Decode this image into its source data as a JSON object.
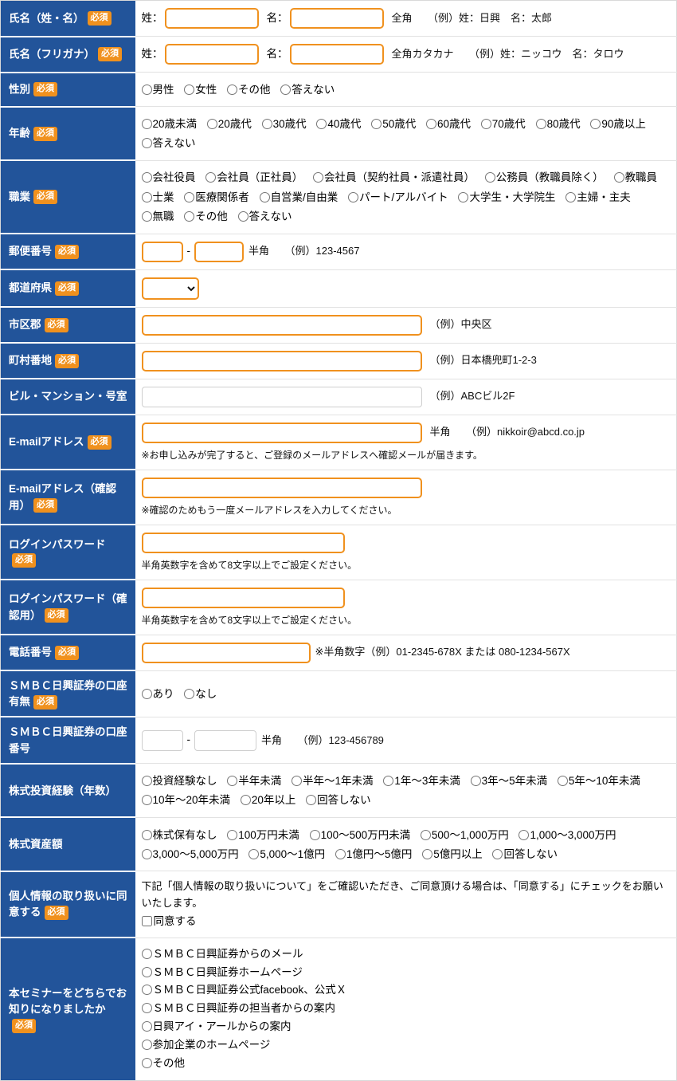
{
  "theme": {
    "label_bg": "#22549A",
    "required_badge_bg": "#F0911E",
    "input_border": "#F0911E",
    "optional_input_border": "#cfcfcf",
    "row_divider": "#e2e2e2"
  },
  "badges": {
    "required": "必須"
  },
  "rows": {
    "name": {
      "label": "氏名（姓・名）",
      "required": true,
      "sei_label": "姓：",
      "mei_label": "名：",
      "sei_value": "",
      "mei_value": "",
      "hint": "全角　　（例）姓：日興　名：太郎"
    },
    "furigana": {
      "label": "氏名（フリガナ）",
      "required": true,
      "sei_label": "姓：",
      "mei_label": "名：",
      "sei_value": "",
      "mei_value": "",
      "hint": "全角カタカナ　　（例）姓：ニッコウ　名：タロウ"
    },
    "gender": {
      "label": "性別",
      "required": true,
      "options": [
        "男性",
        "女性",
        "その他",
        "答えない"
      ]
    },
    "age": {
      "label": "年齢",
      "required": true,
      "options": [
        "20歳未満",
        "20歳代",
        "30歳代",
        "40歳代",
        "50歳代",
        "60歳代",
        "70歳代",
        "80歳代",
        "90歳以上",
        "答えない"
      ]
    },
    "occupation": {
      "label": "職業",
      "required": true,
      "options": [
        "会社役員",
        "会社員（正社員）",
        "会社員（契約社員・派遣社員）",
        "公務員（教職員除く）",
        "教職員",
        "士業",
        "医療関係者",
        "自営業/自由業",
        "パート/アルバイト",
        "大学生・大学院生",
        "主婦・主夫",
        "無職",
        "その他",
        "答えない"
      ]
    },
    "postal": {
      "label": "郵便番号",
      "required": true,
      "value_a": "",
      "value_b": "",
      "separator": "-",
      "hint": "半角　　（例）123-4567"
    },
    "prefecture": {
      "label": "都道府県",
      "required": true,
      "selected": "",
      "options": [
        ""
      ]
    },
    "city": {
      "label": "市区郡",
      "required": true,
      "value": "",
      "hint": "（例）中央区"
    },
    "town": {
      "label": "町村番地",
      "required": true,
      "value": "",
      "hint": "（例）日本橋兜町1-2-3"
    },
    "building": {
      "label": "ビル・マンション・号室",
      "required": false,
      "value": "",
      "hint": "（例）ABCビル2F"
    },
    "email": {
      "label": "E-mailアドレス",
      "required": true,
      "value": "",
      "hint": "半角　　（例）nikkoir@abcd.co.jp",
      "note": "※お申し込みが完了すると、ご登録のメールアドレスへ確認メールが届きます。"
    },
    "email_confirm": {
      "label": "E-mailアドレス（確認用）",
      "required": true,
      "value": "",
      "note": "※確認のためもう一度メールアドレスを入力してください。"
    },
    "password": {
      "label": "ログインパスワード",
      "required": true,
      "value": "",
      "note": "半角英数字を含めて8文字以上でご設定ください。"
    },
    "password_confirm": {
      "label": "ログインパスワード（確認用）",
      "required": true,
      "value": "",
      "note": "半角英数字を含めて8文字以上でご設定ください。"
    },
    "tel": {
      "label": "電話番号",
      "required": true,
      "value": "",
      "hint": "※半角数字（例）01-2345-678X または 080-1234-567X"
    },
    "smbc_account": {
      "label": "ＳＭＢＣ日興証券の口座有無",
      "required": true,
      "options": [
        "あり",
        "なし"
      ]
    },
    "smbc_account_no": {
      "label": "ＳＭＢＣ日興証券の口座番号",
      "required": false,
      "value_a": "",
      "value_b": "",
      "separator": "-",
      "hint": "半角　　（例）123-456789"
    },
    "experience": {
      "label": "株式投資経験（年数）",
      "required": false,
      "options": [
        "投資経験なし",
        "半年未満",
        "半年～1年未満",
        "1年～3年未満",
        "3年～5年未満",
        "5年～10年未満",
        "10年～20年未満",
        "20年以上",
        "回答しない"
      ]
    },
    "assets": {
      "label": "株式資産額",
      "required": false,
      "options": [
        "株式保有なし",
        "100万円未満",
        "100～500万円未満",
        "500～1,000万円",
        "1,000～3,000万円",
        "3,000～5,000万円",
        "5,000～1億円",
        "1億円～5億円",
        "5億円以上",
        "回答しない"
      ]
    },
    "privacy": {
      "label": "個人情報の取り扱いに同意する",
      "required": true,
      "description": "下記「個人情報の取り扱いについて」をご確認いただき、ご同意頂ける場合は、「同意する」にチェックをお願いいたします。",
      "checkbox_label": "同意する",
      "checked": false
    },
    "source": {
      "label": "本セミナーをどちらでお知りになりましたか",
      "required": true,
      "options": [
        "ＳＭＢＣ日興証券からのメール",
        "ＳＭＢＣ日興証券ホームページ",
        "ＳＭＢＣ日興証券公式facebook、公式Ｘ",
        "ＳＭＢＣ日興証券の担当者からの案内",
        "日興アイ・アールからの案内",
        "参加企業のホームページ",
        "その他"
      ]
    }
  }
}
